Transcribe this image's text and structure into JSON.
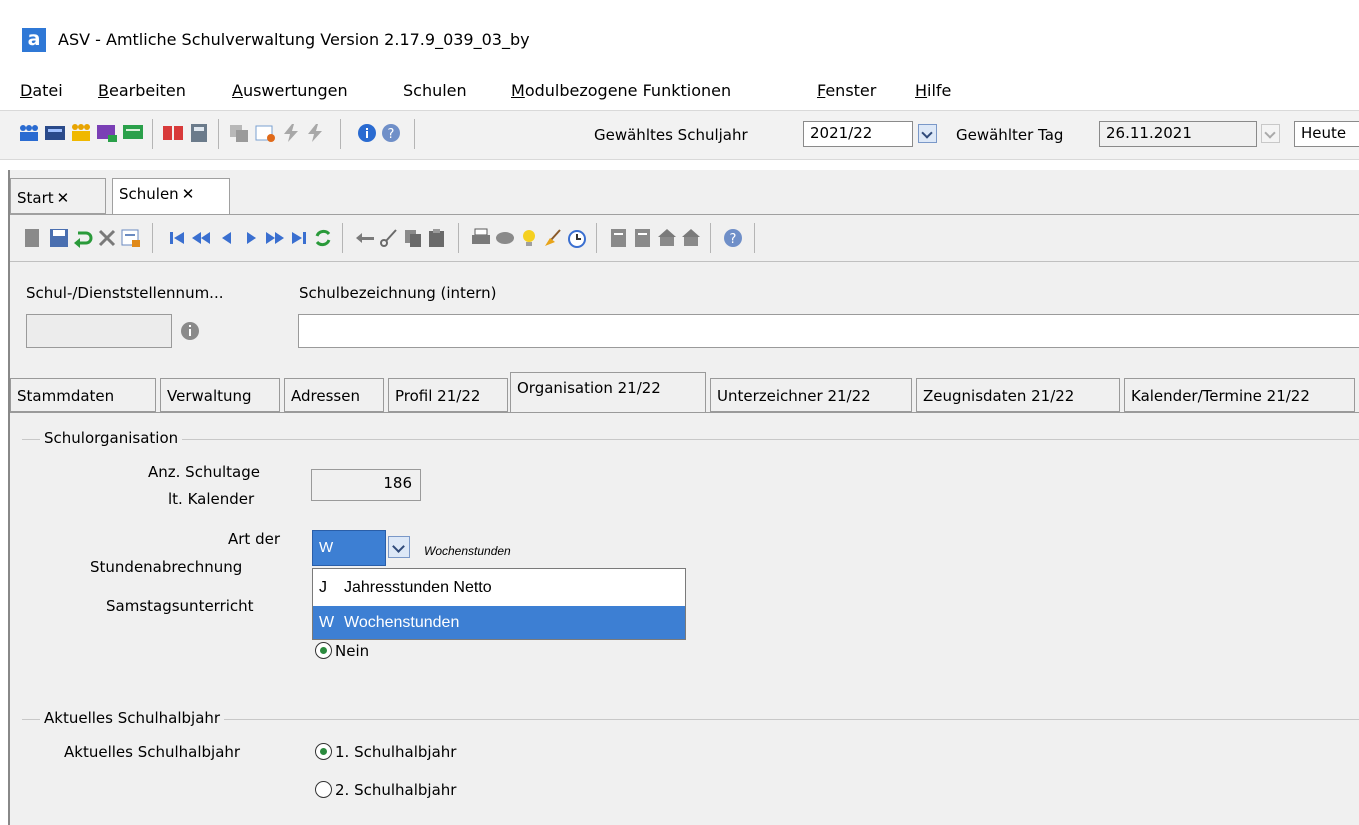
{
  "window": {
    "title": "ASV - Amtliche Schulverwaltung Version 2.17.9_039_03_by",
    "logo_letter": "a"
  },
  "menu": [
    {
      "label": "Datei",
      "u": "D",
      "rest": "atei"
    },
    {
      "label": "Bearbeiten",
      "u": "B",
      "rest": "earbeiten"
    },
    {
      "label": "Auswertungen",
      "u": "A",
      "rest": "uswertungen"
    },
    {
      "label": "Schulen",
      "u": "",
      "rest": "Schulen"
    },
    {
      "label": "Modulbezogene Funktionen",
      "u": "M",
      "rest": "odulbezogene Funktionen"
    },
    {
      "label": "Fenster",
      "u": "F",
      "rest": "enster"
    },
    {
      "label": "Hilfe",
      "u": "H",
      "rest": "ilfe"
    }
  ],
  "toolbar": {
    "schuljahr_label": "Gewähltes Schuljahr",
    "schuljahr_value": "2021/22",
    "tag_label": "Gewählter Tag",
    "tag_value": "26.11.2021",
    "today_button": "Heute"
  },
  "doc_tabs": [
    {
      "label": "Start",
      "close": "✕"
    },
    {
      "label": "Schulen",
      "close": "✕"
    }
  ],
  "header_form": {
    "nummer_label": "Schul-/Dienststellennum...",
    "bezeichnung_label": "Schulbezeichnung (intern)",
    "nummer_value": "",
    "bezeichnung_value": ""
  },
  "sub_tabs": [
    "Stammdaten",
    "Verwaltung",
    "Adressen",
    "Profil 21/22",
    "Organisation 21/22",
    "Unterzeichner 21/22",
    "Zeugnisdaten 21/22",
    "Kalender/Termine 21/22"
  ],
  "schulorganisation": {
    "title": "Schulorganisation",
    "schultage_label_1": "Anz. Schultage",
    "schultage_label_2": "lt. Kalender",
    "schultage_value": "186",
    "art_label_1": "Art der",
    "art_label_2": "Stundenabrechnung",
    "art_value": "W",
    "art_hint": "Wochenstunden",
    "art_options": [
      {
        "code": "J",
        "label": "Jahresstunden Netto"
      },
      {
        "code": "W",
        "label": "Wochenstunden"
      }
    ],
    "samstag_label": "Samstagsunterricht",
    "samstag_option_nein": "Nein"
  },
  "halbjahr": {
    "title": "Aktuelles Schulhalbjahr",
    "label": "Aktuelles Schulhalbjahr",
    "option1": "1. Schulhalbjahr",
    "option2": "2. Schulhalbjahr"
  },
  "colors": {
    "accent": "#3d7fd3",
    "radio_dot": "#2b8a3e"
  }
}
